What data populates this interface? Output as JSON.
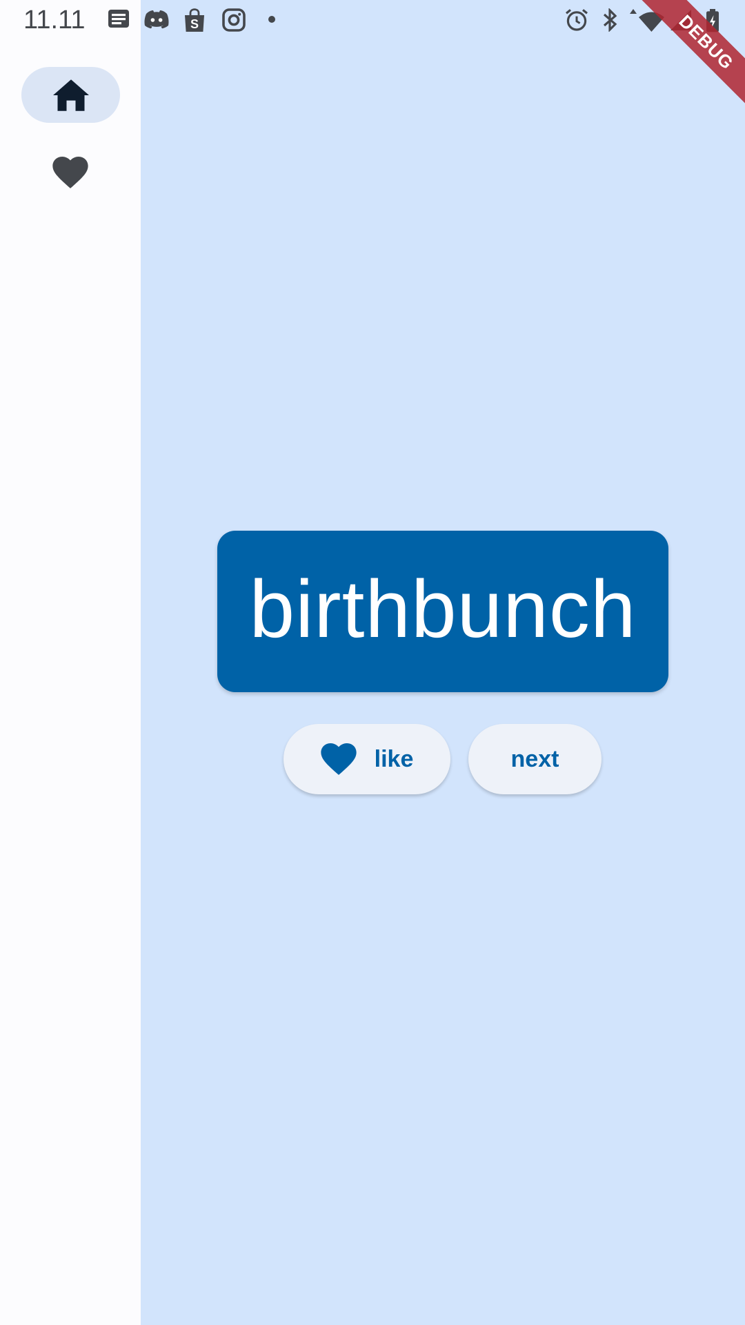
{
  "status_bar": {
    "time": "11.11",
    "left_icons": [
      "message-icon",
      "discord-icon",
      "shopping-bag-icon",
      "instagram-icon",
      "dot-icon"
    ],
    "right_icons": [
      "alarm-icon",
      "bluetooth-icon",
      "wifi-icon",
      "signal-icon",
      "battery-icon"
    ]
  },
  "nav_rail": {
    "items": [
      {
        "name": "home",
        "icon": "home-icon",
        "selected": true
      },
      {
        "name": "favorites",
        "icon": "heart-icon",
        "selected": false
      }
    ]
  },
  "main": {
    "word": "birthbunch",
    "like_label": "like",
    "next_label": "next"
  },
  "debug_banner": {
    "label": "DEBUG"
  },
  "colors": {
    "background": "#d2e4fc",
    "rail": "#fcfcfe",
    "primary": "#0062a7",
    "button_bg": "#eef2f9",
    "rail_indicator": "#dbe5f5"
  }
}
